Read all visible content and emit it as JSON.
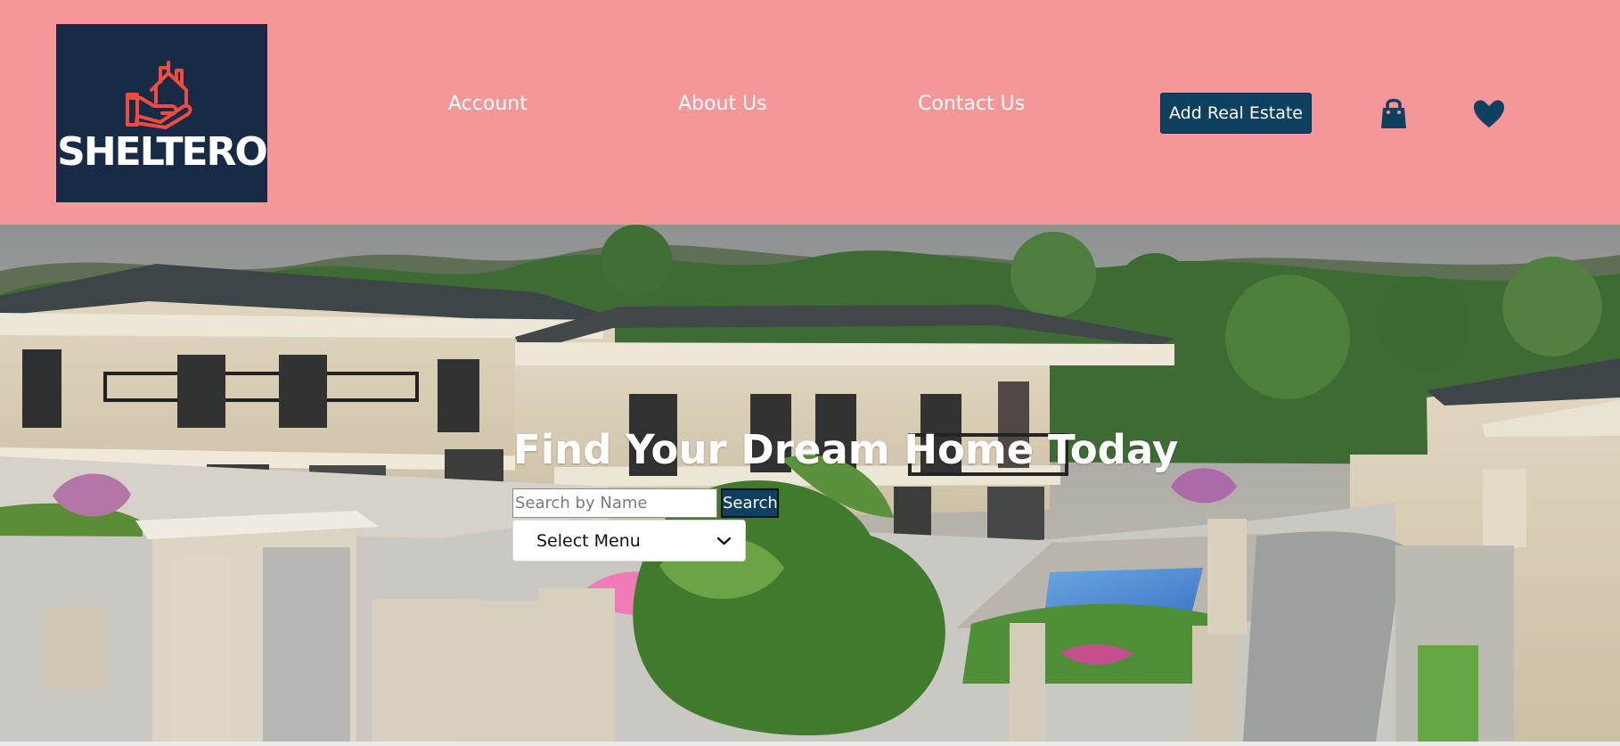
{
  "brand": {
    "name": "SHELTERO"
  },
  "nav": {
    "items": [
      {
        "label": "Account"
      },
      {
        "label": "About Us"
      },
      {
        "label": "Contact Us"
      }
    ]
  },
  "header": {
    "add_label": "Add Real Estate",
    "icons": [
      "shopping-bag-icon",
      "heart-icon"
    ]
  },
  "hero": {
    "title": "Find Your Dream Home Today",
    "search": {
      "placeholder": "Search by Name",
      "value": "",
      "button_label": "Search"
    },
    "select": {
      "label": "Select Menu"
    }
  },
  "colors": {
    "header_background": "#f59698",
    "logo_background": "#182b46",
    "accent": "#0d415f",
    "logo_mark": "#ef4b3f",
    "text_on_header": "#ffffff"
  }
}
